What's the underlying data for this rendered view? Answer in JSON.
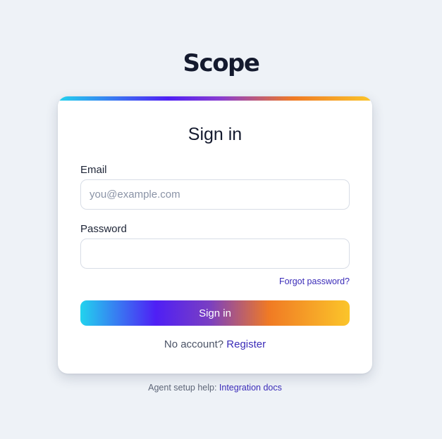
{
  "brand": {
    "logo_text": "Scope"
  },
  "signin_form": {
    "title": "Sign in",
    "email_label": "Email",
    "email_placeholder": "you@example.com",
    "email_value": "",
    "password_label": "Password",
    "password_value": "",
    "forgot_password_link": "Forgot password?",
    "submit_label": "Sign in",
    "no_account_text": "No account?",
    "register_link": "Register"
  },
  "footer": {
    "help_text": "Agent setup help:",
    "docs_link": "Integration docs"
  },
  "colors": {
    "background": "#eef2f7",
    "link": "#3a2bb8",
    "gradient": [
      "#22d3ee",
      "#4f1ff5",
      "#f07a24",
      "#fbc52a"
    ]
  }
}
